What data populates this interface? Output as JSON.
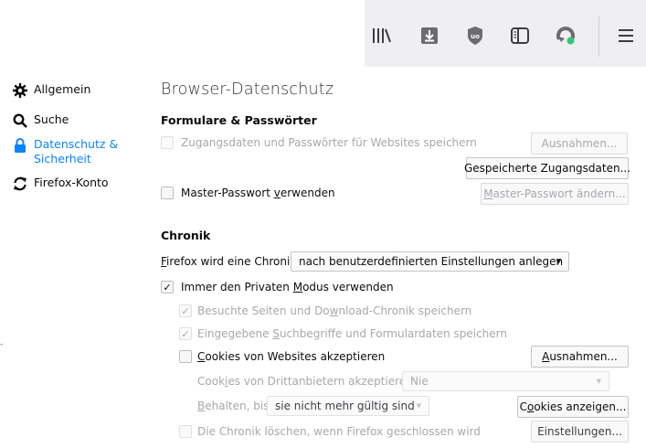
{
  "toolbar": {
    "icons": [
      "library-icon",
      "download-icon",
      "ublock-icon",
      "sidebar-icon",
      "sync-icon",
      "hamburger-menu-icon"
    ]
  },
  "sidebar": {
    "items": [
      {
        "label": "Allgemein",
        "icon": "gear-icon"
      },
      {
        "label": "Suche",
        "icon": "search-icon"
      },
      {
        "label": "Datenschutz & Sicherheit",
        "icon": "lock-icon",
        "active": true
      },
      {
        "label": "Firefox-Konto",
        "icon": "sync-icon"
      }
    ],
    "left_tick": "-"
  },
  "main": {
    "title": "Browser-Datenschutz",
    "forms_section": {
      "heading": "Formulare & Passwörter",
      "save_logins_label": "Zugangsdaten und Passwörter für Websites speichern",
      "exceptions_button": "Ausnahmen...",
      "saved_logins_button": "Gespeicherte Zugangsdaten...",
      "master_password_label_pre": "Master-Passwort ",
      "master_password_label_u": "v",
      "master_password_label_post": "erwenden",
      "change_master_button_u": "M",
      "change_master_button_rest": "aster-Passwort ändern..."
    },
    "history_section": {
      "heading": "Chronik",
      "history_label_u": "F",
      "history_label_rest": "irefox wird eine Chronik",
      "history_select": "nach benutzerdefinierten Einstellungen anlegen",
      "private_mode_pre": "Immer den Privaten ",
      "private_mode_u": "M",
      "private_mode_post": "odus verwenden",
      "visited_pre": "Besuchte Seiten und Do",
      "visited_u": "w",
      "visited_post": "nload-Chronik speichern",
      "search_pre": "Eingegebene ",
      "search_u": "S",
      "search_post": "uchbegriffe und Formulardaten speichern",
      "cookies_u": "C",
      "cookies_rest": "ookies von Websites akzeptieren",
      "cookies_exceptions_u": "A",
      "cookies_exceptions_rest": "usnahmen...",
      "third_party_pre": "Cook",
      "third_party_u": "i",
      "third_party_post": "es von Drittanbietern akzeptieren:",
      "third_party_select": "Nie",
      "keep_until_u": "B",
      "keep_until_rest": "ehalten, bis",
      "keep_until_select": "sie nicht mehr gültig sind",
      "show_cookies_pre": "C",
      "show_cookies_u": "o",
      "show_cookies_post": "okies anzeigen...",
      "clear_on_close_label": "Die Chronik löschen, wenn Firefox geschlossen wird",
      "settings_button": "Einstellungen..."
    }
  },
  "colors": {
    "accent": "#0a84ff",
    "toolbar_bg": "#efeff2",
    "disabled_text": "#a8a8ae"
  }
}
